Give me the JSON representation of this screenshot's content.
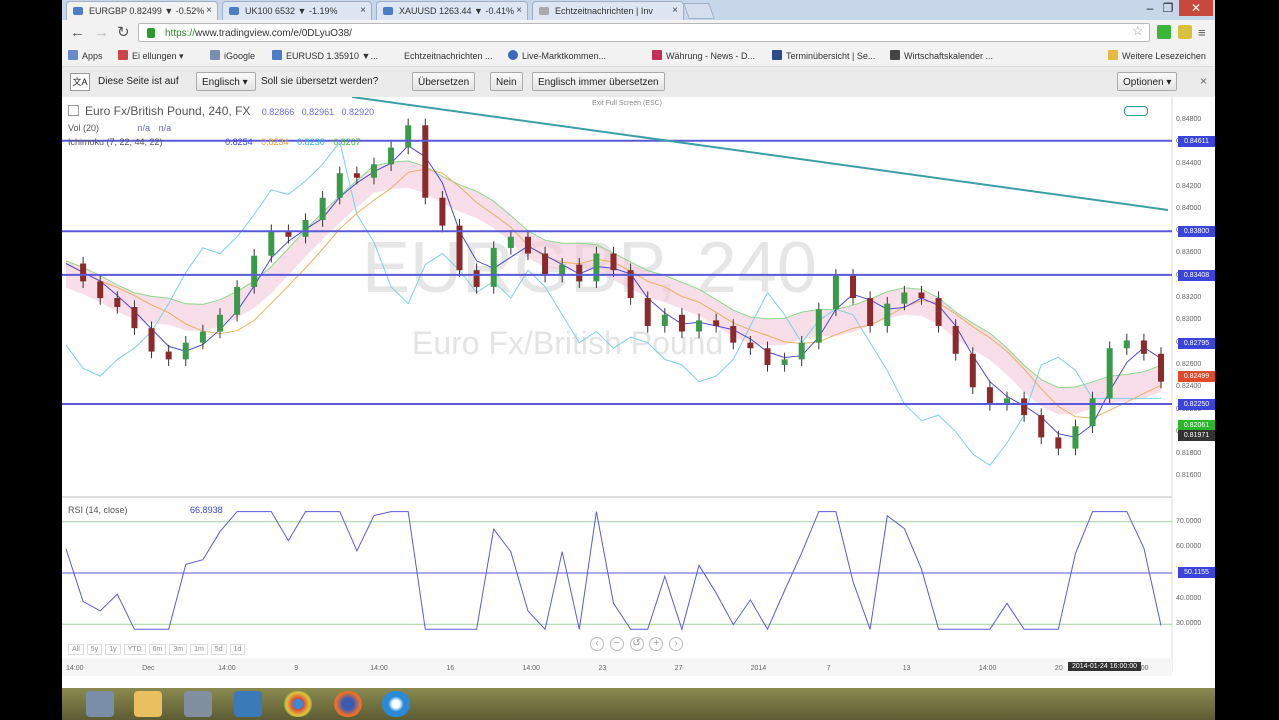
{
  "browser": {
    "tabs": [
      {
        "label": "EURGBP 0.82499 ▼ -0.52%"
      },
      {
        "label": "UK100 6532 ▼ -1.19%"
      },
      {
        "label": "XAUUSD 1263.44 ▼ -0.41%"
      },
      {
        "label": "Echtzeitnachrichten | Inv"
      }
    ],
    "url_scheme": "https://",
    "url_rest": "www.tradingview.com/e/0DLyuO38/"
  },
  "bookmarks": [
    {
      "label": "Apps"
    },
    {
      "label": "Ei  ellungen ▾"
    },
    {
      "label": "iGoogle"
    },
    {
      "label": "EURUSD 1.35910 ▼..."
    },
    {
      "label": "Echtzeitnachrichten ..."
    },
    {
      "label": "Live-Marktkommen..."
    },
    {
      "label": "Währung - News - D..."
    },
    {
      "label": "Terminübersicht | Se..."
    },
    {
      "label": "Wirtschaftskalender ..."
    },
    {
      "label": "Weitere Lesezeichen"
    }
  ],
  "translate": {
    "prefix": "Diese Seite ist auf",
    "language": "Englisch",
    "question": "Soll sie übersetzt werden?",
    "translate_btn": "Übersetzen",
    "no_btn": "Nein",
    "always_btn": "Englisch immer übersetzen",
    "options_btn": "Optionen"
  },
  "chart": {
    "symbol_title": "Euro Fx/British Pound, 240, FX",
    "ohlc": [
      "0.82866",
      "0.82961",
      "0.82920"
    ],
    "exit_hint": "Exit Full Screen (ESC)",
    "vol_label": "Vol (20)",
    "vol_values": [
      "n/a",
      "n/a"
    ],
    "ichimoku_label": "Ichimoku (7, 22, 44, 22)",
    "ichimoku_values": [
      "0.8254",
      "0.8234",
      "0.8230",
      "0.8267"
    ],
    "watermark_symbol": "EURGBP, 240",
    "watermark_name": "Euro Fx/British Pound",
    "price_ticks": [
      "0.84800",
      "0.84600",
      "0.84400",
      "0.84200",
      "0.84000",
      "0.83800",
      "0.83600",
      "0.83400",
      "0.83200",
      "0.83000",
      "0.82800",
      "0.82600",
      "0.82400",
      "0.82200",
      "0.82000",
      "0.81800",
      "0.81600"
    ],
    "price_boxes": [
      {
        "label": "0.84611",
        "color": "#3a44d8"
      },
      {
        "label": "0.83800",
        "color": "#3a44d8"
      },
      {
        "label": "0.83408",
        "color": "#3a44d8"
      },
      {
        "label": "0.82795",
        "color": "#3a44d8"
      },
      {
        "label": "0.82499",
        "color": "#e04a2a"
      },
      {
        "label": "0.82250",
        "color": "#3a44d8"
      },
      {
        "label": "0.82061",
        "color": "#2ab82a"
      },
      {
        "label": "0.81971",
        "color": "#333333"
      }
    ],
    "rsi_label": "RSI (14, close)",
    "rsi_value": "66.8938",
    "rsi_ticks": [
      "70.0000",
      "60.0000",
      "40.0000",
      "30.0000"
    ],
    "rsi_box": "50.1155",
    "time_ticks": [
      "14:00",
      "Dec",
      "14:00",
      "9",
      "14:00",
      "16",
      "14:00",
      "23",
      "27",
      "2014",
      "7",
      "13",
      "14:00",
      "20",
      "14:00"
    ],
    "time_box": "2014-01-24 16:00:00",
    "range_buttons": [
      "All",
      "5y",
      "1y",
      "YTD",
      "6m",
      "3m",
      "1m",
      "5d",
      "1d"
    ]
  },
  "chart_data": {
    "type": "line",
    "title": "Euro Fx/British Pound, 240, FX",
    "xlabel": "",
    "ylabel": "",
    "ylim": [
      0.8155,
      0.8495
    ],
    "x_ticks": [
      "14:00",
      "Dec",
      "14:00",
      "9",
      "14:00",
      "16",
      "14:00",
      "23",
      "27",
      "2014",
      "7",
      "13",
      "14:00",
      "20",
      "14:00"
    ],
    "series": [
      {
        "values": [
          0.8351,
          0.8335,
          0.832,
          0.8312,
          0.8293,
          0.8272,
          0.8265,
          0.828,
          0.829,
          0.8305,
          0.833,
          0.8358,
          0.838,
          0.8375,
          0.839,
          0.841,
          0.8432,
          0.8428,
          0.844,
          0.8455,
          0.8475,
          0.841,
          0.8385,
          0.8345,
          0.833,
          0.8365,
          0.8375,
          0.836,
          0.834,
          0.835,
          0.8335,
          0.836,
          0.8345,
          0.832,
          0.8295,
          0.8305,
          0.829,
          0.83,
          0.8295,
          0.828,
          0.8275,
          0.826,
          0.8265,
          0.828,
          0.831,
          0.834,
          0.832,
          0.8295,
          0.8315,
          0.8325,
          0.832,
          0.8295,
          0.827,
          0.824,
          0.8225,
          0.823,
          0.8215,
          0.8195,
          0.8185,
          0.8205,
          0.823,
          0.8275,
          0.8282,
          0.827,
          0.8245
        ]
      }
    ],
    "horizontal_lines": [
      0.84611,
      0.838,
      0.83408,
      0.8225
    ],
    "rsi": {
      "ylim": [
        25,
        75
      ],
      "levels": [
        70,
        30
      ],
      "last": 66.8938
    }
  }
}
